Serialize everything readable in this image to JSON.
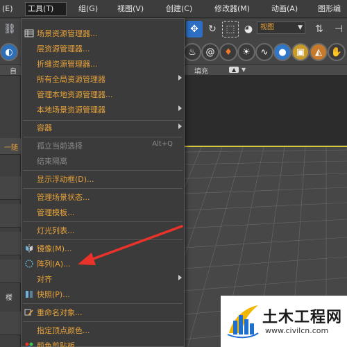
{
  "menubar": {
    "items": [
      {
        "label": "(E)"
      },
      {
        "label": "工具(T)"
      },
      {
        "label": "组(G)"
      },
      {
        "label": "视图(V)"
      },
      {
        "label": "创建(C)"
      },
      {
        "label": "修改器(M)"
      },
      {
        "label": "动画(A)"
      },
      {
        "label": "图形编"
      }
    ]
  },
  "toolbar": {
    "view_select": "视图"
  },
  "ribbon": {
    "left_label": "自",
    "fill_label": "填充"
  },
  "left_panel": {
    "first_label": "一随",
    "lower_label": "楼"
  },
  "tools_menu": {
    "items": [
      {
        "label": "场景资源管理器...",
        "icon": "table-icon",
        "enabled": true
      },
      {
        "label": "层资源管理器...",
        "enabled": true
      },
      {
        "label": "折缝资源管理器...",
        "enabled": true
      },
      {
        "label": "所有全局资源管理器",
        "enabled": true,
        "submenu": true
      },
      {
        "label": "管理本地资源管理器...",
        "enabled": true
      },
      {
        "label": "本地场景资源管理器",
        "enabled": true,
        "submenu": true
      },
      {
        "label": "容器",
        "enabled": true,
        "submenu": true
      },
      {
        "label": "孤立当前选择",
        "enabled": false,
        "shortcut": "Alt+Q"
      },
      {
        "label": "结束隔离",
        "enabled": false
      },
      {
        "label": "显示浮动框(D)...",
        "enabled": true
      },
      {
        "label": "管理场景状态...",
        "enabled": true
      },
      {
        "label": "管理模板...",
        "enabled": true
      },
      {
        "label": "灯光列表...",
        "enabled": true
      },
      {
        "label": "镜像(M)...",
        "icon": "mirror-icon",
        "enabled": true
      },
      {
        "label": "阵列(A)...",
        "icon": "array-icon",
        "enabled": true
      },
      {
        "label": "对齐",
        "enabled": true,
        "submenu": true
      },
      {
        "label": "快照(P)...",
        "icon": "snapshot-icon",
        "enabled": true
      },
      {
        "label": "重命名对象...",
        "icon": "rename-icon",
        "enabled": true
      },
      {
        "label": "指定顶点颜色...",
        "enabled": true
      },
      {
        "label": "颜色剪贴板...",
        "icon": "color-clipboard-icon",
        "enabled": true
      }
    ]
  },
  "watermark": {
    "title": "土木工程网",
    "url": "www.civilcn.com"
  },
  "colors": {
    "menu_text": "#e8a33a",
    "disabled_text": "#8a8a8a",
    "viewport_border": "#d8c838",
    "annotation_arrow": "#e8322a"
  }
}
